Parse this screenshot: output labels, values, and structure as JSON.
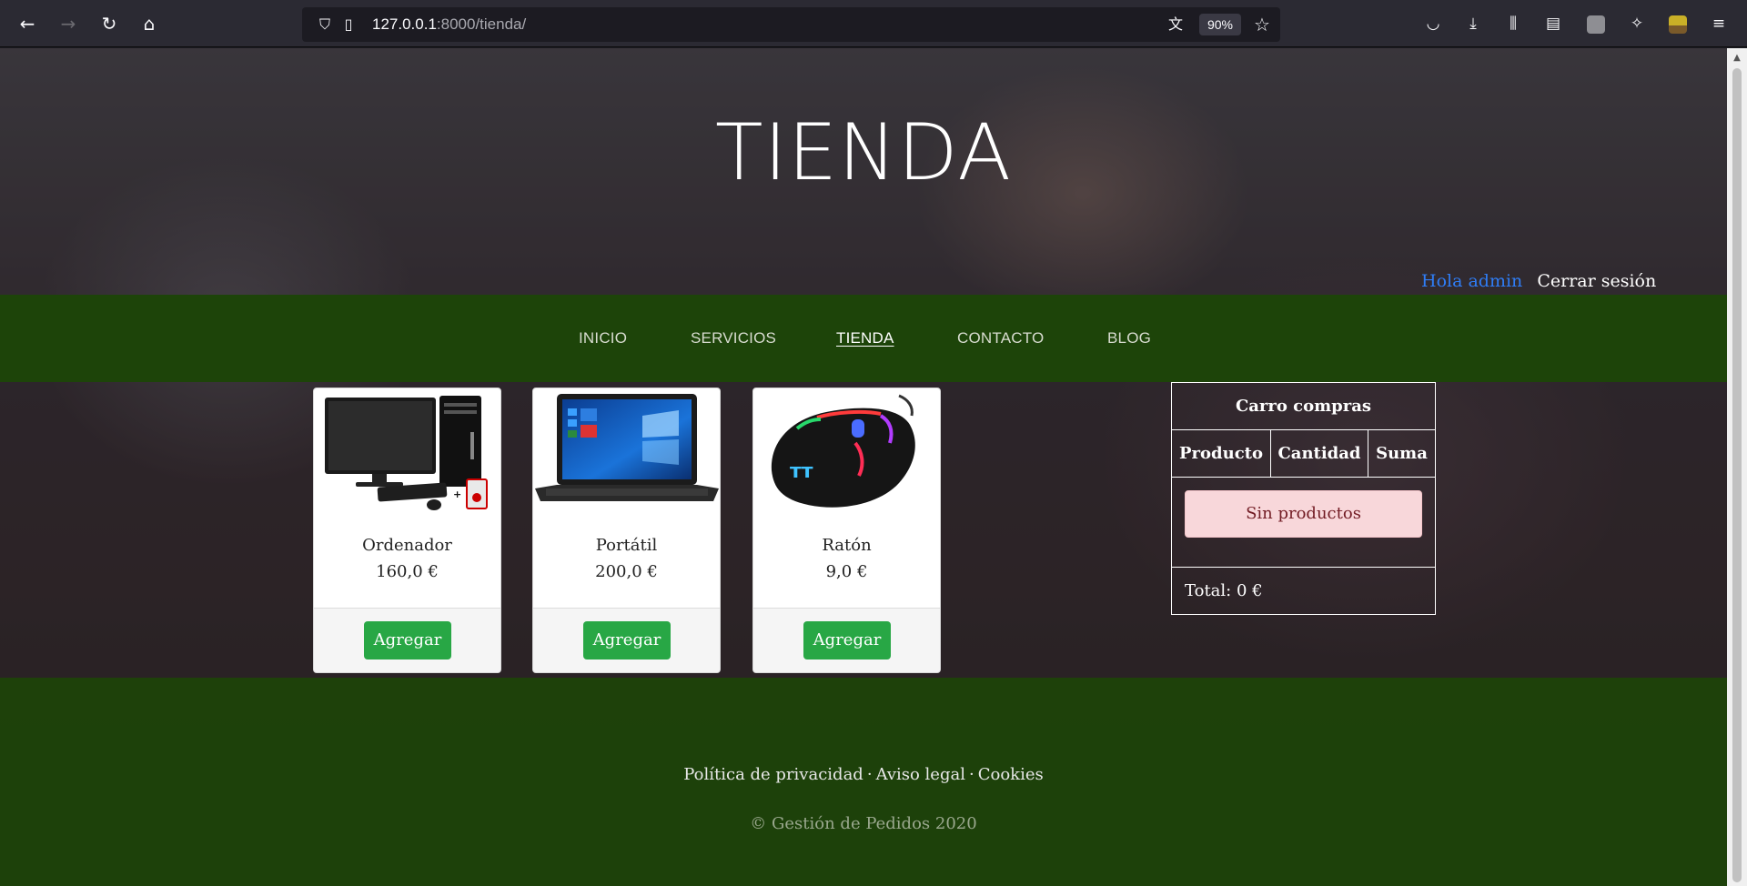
{
  "browser": {
    "url_host": "127.0.0.1",
    "url_path": ":8000/tienda/",
    "zoom": "90%",
    "icons": [
      "back-icon",
      "forward-icon",
      "reload-icon",
      "home-icon",
      "shield-icon",
      "page-icon",
      "translate-icon",
      "bookmark-star-icon",
      "pocket-icon",
      "download-icon",
      "library-icon",
      "sidebar-icon",
      "extension-icon",
      "puzzle-icon",
      "profile-icon",
      "menu-icon"
    ]
  },
  "header": {
    "title": "TIENDA",
    "greeting": "Hola admin",
    "logout": "Cerrar sesión"
  },
  "nav": {
    "items": [
      "INICIO",
      "SERVICIOS",
      "TIENDA",
      "CONTACTO",
      "BLOG"
    ],
    "active": "TIENDA"
  },
  "products": [
    {
      "name": "Ordenador",
      "price": "160,0 €",
      "button": "Agregar"
    },
    {
      "name": "Portátil",
      "price": "200,0 €",
      "button": "Agregar"
    },
    {
      "name": "Ratón",
      "price": "9,0 €",
      "button": "Agregar"
    }
  ],
  "cart": {
    "title": "Carro compras",
    "columns": [
      "Producto",
      "Cantidad",
      "Suma"
    ],
    "empty_message": "Sin productos",
    "total": "Total: 0 €"
  },
  "footer": {
    "links": [
      "Política de privacidad",
      "Aviso legal",
      "Cookies"
    ],
    "separator": "·",
    "copyright": "© Gestión de Pedidos 2020"
  },
  "colors": {
    "nav_green": "#1d4409",
    "button_green": "#28a745",
    "greeting_blue": "#2f7df6",
    "alert_pink": "#f8d7da"
  }
}
